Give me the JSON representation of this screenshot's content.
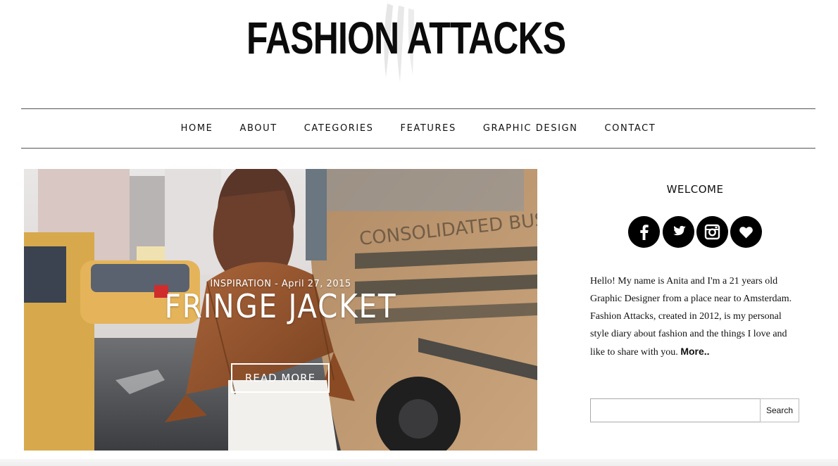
{
  "header": {
    "logo_text": "FASHION ATTACKS"
  },
  "nav": {
    "items": [
      {
        "label": "HOME"
      },
      {
        "label": "ABOUT"
      },
      {
        "label": "CATEGORIES"
      },
      {
        "label": "FEATURES"
      },
      {
        "label": "GRAPHIC DESIGN"
      },
      {
        "label": "CONTACT"
      }
    ]
  },
  "featured": {
    "meta": "INSPIRATION - April 27, 2015",
    "title": "FRINGE JACKET",
    "button_label": "READ MORE",
    "bus_text": "CONSOLIDATED BUS TRANSIT"
  },
  "sidebar": {
    "welcome_title": "WELCOME",
    "socials": [
      {
        "icon": "facebook-icon"
      },
      {
        "icon": "twitter-icon"
      },
      {
        "icon": "instagram-icon"
      },
      {
        "icon": "heart-icon"
      }
    ],
    "bio_lines": [
      "Hello! My name is Anita and I'm a 21 years old",
      "Graphic Designer from a place near to Amsterdam.",
      "Fashion Attacks, created in 2012, is my personal",
      "style diary about fashion and the things I love and",
      "like to share with you."
    ],
    "more_label": "More..",
    "search": {
      "placeholder": "",
      "button_label": "Search"
    }
  },
  "colors": {
    "text": "#111111",
    "nav_border": "#555555",
    "icon_bg": "#000000",
    "photo_bus": "#b9936c"
  }
}
